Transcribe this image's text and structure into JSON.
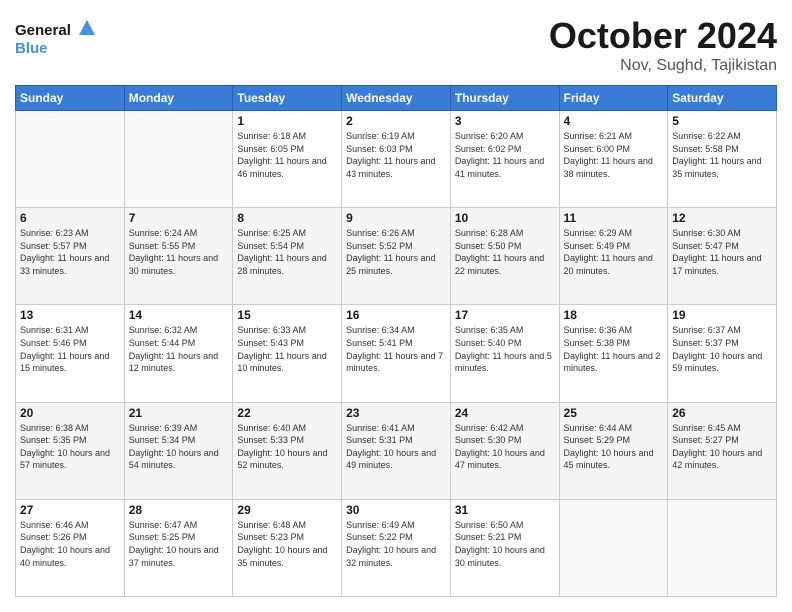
{
  "logo": {
    "line1": "General",
    "line2": "Blue"
  },
  "title": "October 2024",
  "location": "Nov, Sughd, Tajikistan",
  "days_of_week": [
    "Sunday",
    "Monday",
    "Tuesday",
    "Wednesday",
    "Thursday",
    "Friday",
    "Saturday"
  ],
  "weeks": [
    [
      {
        "day": "",
        "info": ""
      },
      {
        "day": "",
        "info": ""
      },
      {
        "day": "1",
        "info": "Sunrise: 6:18 AM\nSunset: 6:05 PM\nDaylight: 11 hours and 46 minutes."
      },
      {
        "day": "2",
        "info": "Sunrise: 6:19 AM\nSunset: 6:03 PM\nDaylight: 11 hours and 43 minutes."
      },
      {
        "day": "3",
        "info": "Sunrise: 6:20 AM\nSunset: 6:02 PM\nDaylight: 11 hours and 41 minutes."
      },
      {
        "day": "4",
        "info": "Sunrise: 6:21 AM\nSunset: 6:00 PM\nDaylight: 11 hours and 38 minutes."
      },
      {
        "day": "5",
        "info": "Sunrise: 6:22 AM\nSunset: 5:58 PM\nDaylight: 11 hours and 35 minutes."
      }
    ],
    [
      {
        "day": "6",
        "info": "Sunrise: 6:23 AM\nSunset: 5:57 PM\nDaylight: 11 hours and 33 minutes."
      },
      {
        "day": "7",
        "info": "Sunrise: 6:24 AM\nSunset: 5:55 PM\nDaylight: 11 hours and 30 minutes."
      },
      {
        "day": "8",
        "info": "Sunrise: 6:25 AM\nSunset: 5:54 PM\nDaylight: 11 hours and 28 minutes."
      },
      {
        "day": "9",
        "info": "Sunrise: 6:26 AM\nSunset: 5:52 PM\nDaylight: 11 hours and 25 minutes."
      },
      {
        "day": "10",
        "info": "Sunrise: 6:28 AM\nSunset: 5:50 PM\nDaylight: 11 hours and 22 minutes."
      },
      {
        "day": "11",
        "info": "Sunrise: 6:29 AM\nSunset: 5:49 PM\nDaylight: 11 hours and 20 minutes."
      },
      {
        "day": "12",
        "info": "Sunrise: 6:30 AM\nSunset: 5:47 PM\nDaylight: 11 hours and 17 minutes."
      }
    ],
    [
      {
        "day": "13",
        "info": "Sunrise: 6:31 AM\nSunset: 5:46 PM\nDaylight: 11 hours and 15 minutes."
      },
      {
        "day": "14",
        "info": "Sunrise: 6:32 AM\nSunset: 5:44 PM\nDaylight: 11 hours and 12 minutes."
      },
      {
        "day": "15",
        "info": "Sunrise: 6:33 AM\nSunset: 5:43 PM\nDaylight: 11 hours and 10 minutes."
      },
      {
        "day": "16",
        "info": "Sunrise: 6:34 AM\nSunset: 5:41 PM\nDaylight: 11 hours and 7 minutes."
      },
      {
        "day": "17",
        "info": "Sunrise: 6:35 AM\nSunset: 5:40 PM\nDaylight: 11 hours and 5 minutes."
      },
      {
        "day": "18",
        "info": "Sunrise: 6:36 AM\nSunset: 5:38 PM\nDaylight: 11 hours and 2 minutes."
      },
      {
        "day": "19",
        "info": "Sunrise: 6:37 AM\nSunset: 5:37 PM\nDaylight: 10 hours and 59 minutes."
      }
    ],
    [
      {
        "day": "20",
        "info": "Sunrise: 6:38 AM\nSunset: 5:35 PM\nDaylight: 10 hours and 57 minutes."
      },
      {
        "day": "21",
        "info": "Sunrise: 6:39 AM\nSunset: 5:34 PM\nDaylight: 10 hours and 54 minutes."
      },
      {
        "day": "22",
        "info": "Sunrise: 6:40 AM\nSunset: 5:33 PM\nDaylight: 10 hours and 52 minutes."
      },
      {
        "day": "23",
        "info": "Sunrise: 6:41 AM\nSunset: 5:31 PM\nDaylight: 10 hours and 49 minutes."
      },
      {
        "day": "24",
        "info": "Sunrise: 6:42 AM\nSunset: 5:30 PM\nDaylight: 10 hours and 47 minutes."
      },
      {
        "day": "25",
        "info": "Sunrise: 6:44 AM\nSunset: 5:29 PM\nDaylight: 10 hours and 45 minutes."
      },
      {
        "day": "26",
        "info": "Sunrise: 6:45 AM\nSunset: 5:27 PM\nDaylight: 10 hours and 42 minutes."
      }
    ],
    [
      {
        "day": "27",
        "info": "Sunrise: 6:46 AM\nSunset: 5:26 PM\nDaylight: 10 hours and 40 minutes."
      },
      {
        "day": "28",
        "info": "Sunrise: 6:47 AM\nSunset: 5:25 PM\nDaylight: 10 hours and 37 minutes."
      },
      {
        "day": "29",
        "info": "Sunrise: 6:48 AM\nSunset: 5:23 PM\nDaylight: 10 hours and 35 minutes."
      },
      {
        "day": "30",
        "info": "Sunrise: 6:49 AM\nSunset: 5:22 PM\nDaylight: 10 hours and 32 minutes."
      },
      {
        "day": "31",
        "info": "Sunrise: 6:50 AM\nSunset: 5:21 PM\nDaylight: 10 hours and 30 minutes."
      },
      {
        "day": "",
        "info": ""
      },
      {
        "day": "",
        "info": ""
      }
    ]
  ],
  "colors": {
    "header_bg": "#3a7bd5",
    "header_text": "#ffffff",
    "shaded_row": "#f5f5f5"
  }
}
